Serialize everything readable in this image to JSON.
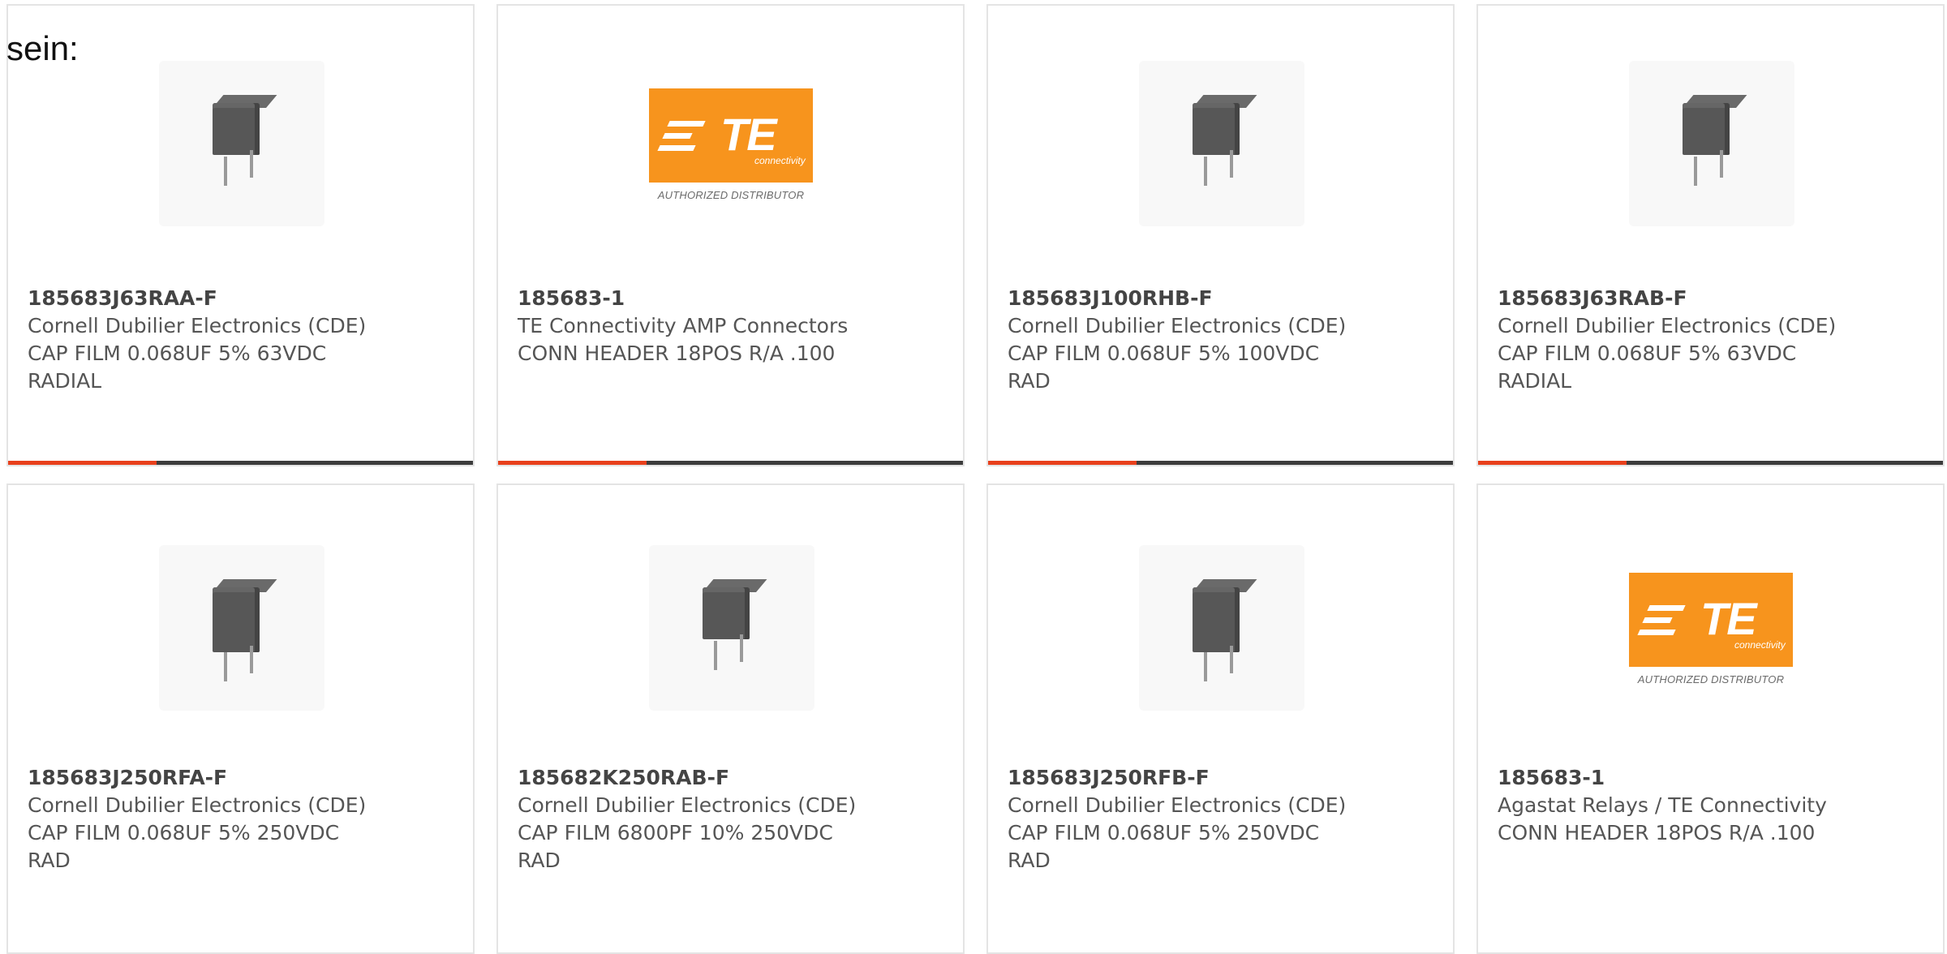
{
  "intro_text": "sein:",
  "colors": {
    "accent": "#e8401c",
    "bar": "#3c3c3c",
    "te_orange": "#f7941d"
  },
  "cards": [
    {
      "image": "capacitor-icon",
      "part_number": "185683J63RAA-F",
      "manufacturer": "Cornell Dubilier Electronics (CDE)",
      "desc1": "CAP FILM 0.068UF 5% 63VDC",
      "desc2": "RADIAL",
      "progress": 0.32
    },
    {
      "image": "te-connectivity-logo",
      "logo_text": "TE",
      "logo_sub": "connectivity",
      "logo_caption": "AUTHORIZED DISTRIBUTOR",
      "part_number": "185683-1",
      "manufacturer": "TE Connectivity AMP Connectors",
      "desc1": "CONN HEADER 18POS R/A .100",
      "desc2": "",
      "progress": 0.32
    },
    {
      "image": "capacitor-icon",
      "part_number": "185683J100RHB-F",
      "manufacturer": "Cornell Dubilier Electronics (CDE)",
      "desc1": "CAP FILM 0.068UF 5% 100VDC",
      "desc2": "RAD",
      "progress": 0.32
    },
    {
      "image": "capacitor-icon",
      "part_number": "185683J63RAB-F",
      "manufacturer": "Cornell Dubilier Electronics (CDE)",
      "desc1": "CAP FILM 0.068UF 5% 63VDC",
      "desc2": "RADIAL",
      "progress": 0.32
    },
    {
      "image": "capacitor-icon",
      "part_number": "185683J250RFA-F",
      "manufacturer": "Cornell Dubilier Electronics (CDE)",
      "desc1": "CAP FILM 0.068UF 5% 250VDC",
      "desc2": "RAD"
    },
    {
      "image": "capacitor-icon",
      "part_number": "185682K250RAB-F",
      "manufacturer": "Cornell Dubilier Electronics (CDE)",
      "desc1": "CAP FILM 6800PF 10% 250VDC",
      "desc2": "RAD"
    },
    {
      "image": "capacitor-icon",
      "part_number": "185683J250RFB-F",
      "manufacturer": "Cornell Dubilier Electronics (CDE)",
      "desc1": "CAP FILM 0.068UF 5% 250VDC",
      "desc2": "RAD"
    },
    {
      "image": "te-connectivity-logo",
      "logo_text": "TE",
      "logo_sub": "connectivity",
      "logo_caption": "AUTHORIZED DISTRIBUTOR",
      "part_number": "185683-1",
      "manufacturer": "Agastat Relays / TE Connectivity",
      "desc1": "CONN HEADER 18POS R/A .100",
      "desc2": ""
    }
  ]
}
